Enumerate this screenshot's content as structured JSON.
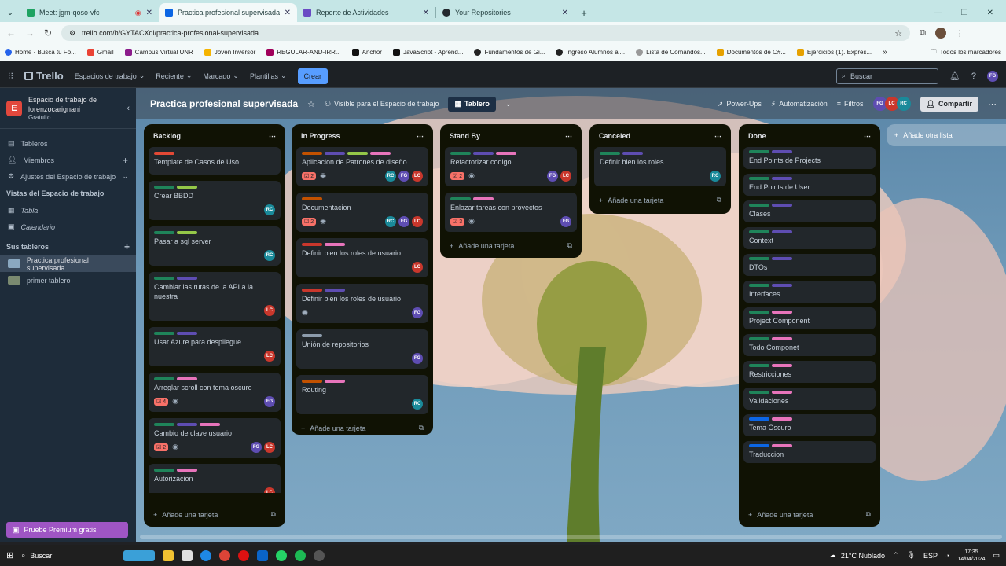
{
  "browser": {
    "tabs": [
      {
        "title": "Meet: jgm-qoso-vfc",
        "color": "#1ea362"
      },
      {
        "title": "Practica profesional supervisada",
        "color": "#0c66e4"
      },
      {
        "title": "Reporte de Actividades",
        "color": "#6a4bc4"
      },
      {
        "title": "Your Repositories",
        "color": "#24292e"
      }
    ],
    "url": "trello.com/b/GYTACXql/practica-profesional-supervisada",
    "bookmarks": [
      "Home - Busca tu Fo...",
      "Gmail",
      "Campus Virtual UNR",
      "Joven Inversor",
      "REGULAR-AND-IRR...",
      "Anchor",
      "JavaScript - Aprend...",
      "Fundamentos de Gi...",
      "Ingreso Alumnos al...",
      "Lista de Comandos...",
      "Documentos de C#...",
      "Ejercicios (1). Expres..."
    ],
    "all_bookmarks": "Todos los marcadores"
  },
  "trello": {
    "logo": "Trello",
    "nav": [
      "Espacios de trabajo",
      "Reciente",
      "Marcado",
      "Plantillas"
    ],
    "create": "Crear",
    "search_placeholder": "Buscar",
    "user_initials": "FG"
  },
  "sidebar": {
    "workspace_initial": "E",
    "workspace_name": "Espacio de trabajo de lorenzocarignani",
    "plan": "Gratuito",
    "items": [
      "Tableros",
      "Miembros",
      "Ajustes del Espacio de trabajo"
    ],
    "views_title": "Vistas del Espacio de trabajo",
    "views": [
      "Tabla",
      "Calendario"
    ],
    "boards_title": "Sus tableros",
    "boards": [
      "Practica profesional supervisada",
      "primer tablero"
    ],
    "premium": "Pruebe Premium gratis"
  },
  "board": {
    "title": "Practica profesional supervisada",
    "visibility": "Visible para el Espacio de trabajo",
    "view": "Tablero",
    "powerups": "Power-Ups",
    "automation": "Automatización",
    "filters": "Filtros",
    "share": "Compartir",
    "add_list": "Añade otra lista",
    "add_card": "Añade una tarjeta"
  },
  "lists": [
    {
      "title": "Backlog",
      "cards": [
        {
          "title": "Template de Casos de Uso",
          "labels": [
            "#e34935"
          ],
          "members": []
        },
        {
          "title": "Crear BBDD",
          "labels": [
            "#1f845a",
            "#94c748"
          ],
          "members": [
            "RC"
          ]
        },
        {
          "title": "Pasar a sql server",
          "labels": [
            "#1f845a",
            "#94c748"
          ],
          "members": [
            "RC"
          ]
        },
        {
          "title": "Cambiar las rutas de la API a la nuestra",
          "labels": [
            "#1f845a",
            "#5e4db2"
          ],
          "members": [
            "LC"
          ]
        },
        {
          "title": "Usar Azure para despliegue",
          "labels": [
            "#1f845a",
            "#5e4db2"
          ],
          "members": [
            "LC"
          ]
        },
        {
          "title": "Arreglar scroll con tema oscuro",
          "labels": [
            "#1f845a",
            "#e774bb"
          ],
          "badge": "4",
          "watch": true,
          "members": [
            "FG"
          ]
        },
        {
          "title": "Cambio de clave usuario",
          "labels": [
            "#1f845a",
            "#5e4db2",
            "#e774bb"
          ],
          "badge": "2",
          "watch": true,
          "members": [
            "FG",
            "LC"
          ]
        },
        {
          "title": "Autorizacion",
          "labels": [
            "#1f845a",
            "#e774bb"
          ],
          "members": [
            "LC"
          ]
        }
      ]
    },
    {
      "title": "In Progress",
      "cards": [
        {
          "title": "Aplicacion de Patrones de diseño",
          "labels": [
            "#c25100",
            "#5e4db2",
            "#94c748",
            "#e774bb"
          ],
          "badge": "2",
          "watch": true,
          "members": [
            "RC",
            "FG",
            "LC"
          ]
        },
        {
          "title": "Documentacion",
          "labels": [
            "#c25100"
          ],
          "badge": "2",
          "watch": true,
          "members": [
            "RC",
            "FG",
            "LC"
          ]
        },
        {
          "title": "Definir bien los roles de usuario",
          "labels": [
            "#c9372c",
            "#e774bb"
          ],
          "members": [
            "LC"
          ]
        },
        {
          "title": "Definir bien los roles de usuario",
          "labels": [
            "#c9372c",
            "#5e4db2"
          ],
          "watch": true,
          "members": [
            "FG"
          ]
        },
        {
          "title": "Unión de repositorios",
          "labels": [
            "#8c9bab"
          ],
          "members": [
            "FG"
          ]
        },
        {
          "title": "Routing",
          "labels": [
            "#c25100",
            "#e774bb"
          ],
          "members": [
            "RC"
          ]
        }
      ]
    },
    {
      "title": "Stand By",
      "cards": [
        {
          "title": "Refactorizar codigo",
          "labels": [
            "#1f845a",
            "#5e4db2",
            "#e774bb"
          ],
          "badge": "2",
          "watch": true,
          "members": [
            "FG",
            "LC"
          ]
        },
        {
          "title": "Enlazar tareas con proyectos",
          "labels": [
            "#1f845a",
            "#e774bb"
          ],
          "badge": "3",
          "watch": true,
          "members": [
            "FG"
          ]
        }
      ]
    },
    {
      "title": "Canceled",
      "cards": [
        {
          "title": "Definir bien los roles",
          "labels": [
            "#1f845a",
            "#5e4db2"
          ],
          "members": [
            "RC"
          ]
        }
      ]
    },
    {
      "title": "Done",
      "cards": [
        {
          "title": "End Points de Projects",
          "labels": [
            "#1f845a",
            "#5e4db2"
          ],
          "members": []
        },
        {
          "title": "End Points de User",
          "labels": [
            "#1f845a",
            "#5e4db2"
          ],
          "members": []
        },
        {
          "title": "Clases",
          "labels": [
            "#1f845a",
            "#5e4db2"
          ],
          "members": []
        },
        {
          "title": "Context",
          "labels": [
            "#1f845a",
            "#5e4db2"
          ],
          "members": []
        },
        {
          "title": "DTOs",
          "labels": [
            "#1f845a",
            "#5e4db2"
          ],
          "members": []
        },
        {
          "title": "Interfaces",
          "labels": [
            "#1f845a",
            "#5e4db2"
          ],
          "members": []
        },
        {
          "title": "Project Component",
          "labels": [
            "#1f845a",
            "#e774bb"
          ],
          "members": []
        },
        {
          "title": "Todo Componet",
          "labels": [
            "#1f845a",
            "#e774bb"
          ],
          "members": []
        },
        {
          "title": "Restricciones",
          "labels": [
            "#1f845a",
            "#e774bb"
          ],
          "members": []
        },
        {
          "title": "Validaciones",
          "labels": [
            "#1f845a",
            "#e774bb"
          ],
          "members": []
        },
        {
          "title": "Tema Oscuro",
          "labels": [
            "#0c66e4",
            "#e774bb"
          ],
          "members": []
        },
        {
          "title": "Traduccion",
          "labels": [
            "#0c66e4",
            "#e774bb"
          ],
          "members": []
        }
      ]
    }
  ],
  "member_colors": {
    "RC": "#1a8a9a",
    "LC": "#c9372c",
    "FG": "#5e4db2"
  },
  "taskbar": {
    "search": "Buscar",
    "weather": "21°C  Nublado",
    "lang": "ESP",
    "time": "17:35",
    "date": "14/04/2024"
  }
}
